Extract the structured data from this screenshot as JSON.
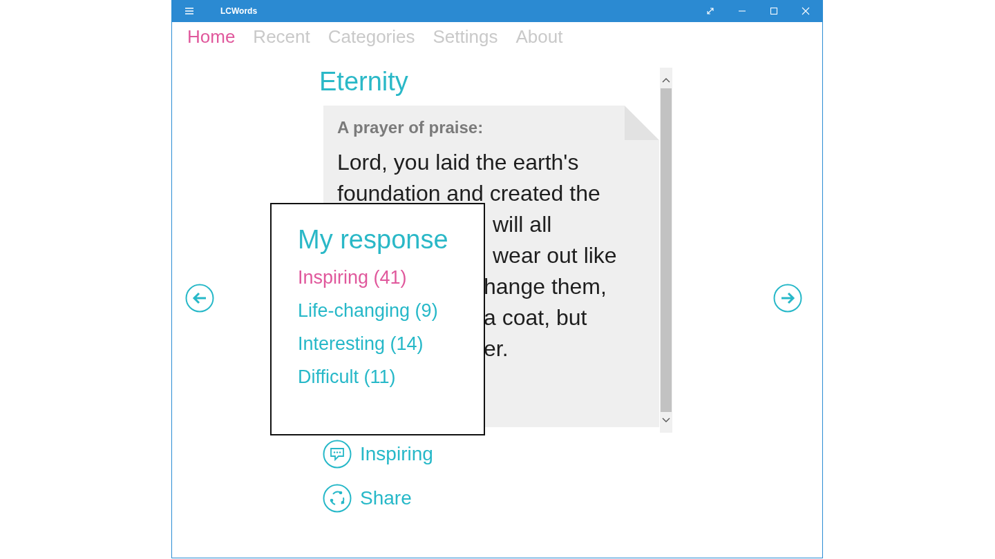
{
  "window": {
    "title": "LCWords"
  },
  "nav": [
    {
      "label": "Home",
      "selected": true
    },
    {
      "label": "Recent",
      "selected": false
    },
    {
      "label": "Categories",
      "selected": false
    },
    {
      "label": "Settings",
      "selected": false
    },
    {
      "label": "About",
      "selected": false
    }
  ],
  "entry": {
    "title": "Eternity",
    "heading": "A prayer of praise:",
    "lines": [
      "Lord, you laid the earth's",
      "foundation and created the",
      "will all",
      "wear out like",
      "hange them,",
      "a coat, but",
      "er."
    ]
  },
  "popup": {
    "title": "My response",
    "options": [
      {
        "label": "Inspiring (41)",
        "selected": true
      },
      {
        "label": "Life-changing (9)",
        "selected": false
      },
      {
        "label": "Interesting (14)",
        "selected": false
      },
      {
        "label": "Difficult (11)",
        "selected": false
      }
    ]
  },
  "actions": [
    {
      "kind": "response",
      "label": "Inspiring"
    },
    {
      "kind": "share",
      "label": "Share"
    }
  ]
}
